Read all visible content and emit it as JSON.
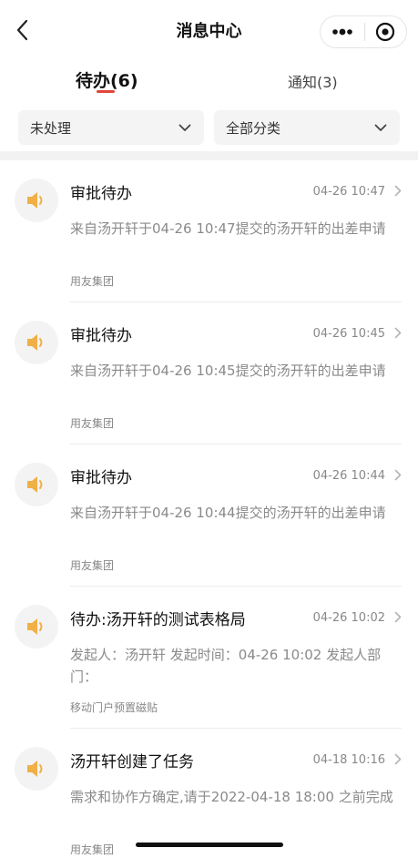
{
  "nav": {
    "title": "消息中心",
    "back_icon": "chevron-left-icon",
    "more_icon": "more-dots-icon",
    "target_icon": "target-icon"
  },
  "tabs": [
    {
      "label": "待办(6)",
      "active": true
    },
    {
      "label": "通知(3)",
      "active": false
    }
  ],
  "filters": {
    "status": {
      "selected": "未处理"
    },
    "category": {
      "selected": "全部分类"
    }
  },
  "colors": {
    "accent": "#e0463c",
    "speaker_icon": "#f0b045",
    "muted_text": "#8a8a8a"
  },
  "messages": [
    {
      "title": "审批待办",
      "time": "04-26 10:47",
      "desc": "来自汤开轩于04-26 10:47提交的汤开轩的出差申请",
      "source": "用友集团",
      "icon": "speaker-icon"
    },
    {
      "title": "审批待办",
      "time": "04-26 10:45",
      "desc": "来自汤开轩于04-26 10:45提交的汤开轩的出差申请",
      "source": "用友集团",
      "icon": "speaker-icon"
    },
    {
      "title": "审批待办",
      "time": "04-26 10:44",
      "desc": "来自汤开轩于04-26 10:44提交的汤开轩的出差申请",
      "source": "用友集团",
      "icon": "speaker-icon"
    },
    {
      "title": "待办:汤开轩的测试表格局",
      "time": "04-26 10:02",
      "desc": "发起人：汤开轩 发起时间：04-26 10:02 发起人部门：",
      "source": "移动门户预置磁贴",
      "icon": "speaker-icon"
    },
    {
      "title": "汤开轩创建了任务",
      "time": "04-18 10:16",
      "desc": "需求和协作方确定,请于2022-04-18 18:00 之前完成",
      "source": "用友集团",
      "icon": "speaker-icon"
    }
  ]
}
